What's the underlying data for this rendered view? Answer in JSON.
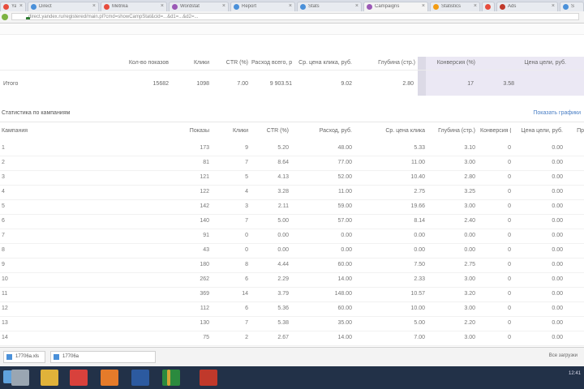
{
  "browser": {
    "tabs": [
      {
        "title": "Yandex",
        "favicon_color": "#e74c3c"
      },
      {
        "title": "Direct",
        "favicon_color": "#4a90d9"
      },
      {
        "title": "Metrika",
        "favicon_color": "#e74c3c"
      },
      {
        "title": "Wordstat",
        "favicon_color": "#9b59b6"
      },
      {
        "title": "Report",
        "favicon_color": "#4a90d9"
      },
      {
        "title": "Stats",
        "favicon_color": "#4a90d9"
      },
      {
        "title": "Campaigns",
        "favicon_color": "#9b59b6"
      },
      {
        "title": "Statistics",
        "favicon_color": "#f39c12"
      },
      {
        "title": "Mail",
        "favicon_color": "#e74c3c"
      },
      {
        "title": "Ads",
        "favicon_color": "#c0392b"
      },
      {
        "title": "Search",
        "favicon_color": "#4a90d9"
      }
    ],
    "address": "direct.yandex.ru/registered/main.pl?cmd=showCampStat&cid=...&d1=...&d2=..."
  },
  "summary": {
    "headers": [
      "",
      "Кол-во показов",
      "Клики",
      "CTR (%)",
      "Расход всего, руб.",
      "Ср. цена клика, руб.",
      "Глубина (стр.)",
      "Конверсия (%)",
      "Цена цели, руб."
    ],
    "row": [
      "Итого",
      "15682",
      "1098",
      "7.00",
      "9 903.51",
      "9.02",
      "2.80",
      "17",
      "3.58"
    ]
  },
  "section": {
    "title": "Статистика по кампаниям",
    "link": "Показать графики"
  },
  "columns": [
    "Кампания",
    "Показы",
    "Клики",
    "CTR (%)",
    "Расход, руб.",
    "Ср. цена клика",
    "Глубина (стр.)",
    "Конверсия (%)",
    "Цена цели, руб.",
    "Пр"
  ],
  "rows": [
    [
      "1",
      "173",
      "9",
      "5.20",
      "48.00",
      "5.33",
      "3.10",
      "0",
      "0.00"
    ],
    [
      "2",
      "81",
      "7",
      "8.64",
      "77.00",
      "11.00",
      "3.00",
      "0",
      "0.00"
    ],
    [
      "3",
      "121",
      "5",
      "4.13",
      "52.00",
      "10.40",
      "2.80",
      "0",
      "0.00"
    ],
    [
      "4",
      "122",
      "4",
      "3.28",
      "11.00",
      "2.75",
      "3.25",
      "0",
      "0.00"
    ],
    [
      "5",
      "142",
      "3",
      "2.11",
      "59.00",
      "19.66",
      "3.00",
      "0",
      "0.00"
    ],
    [
      "6",
      "140",
      "7",
      "5.00",
      "57.00",
      "8.14",
      "2.40",
      "0",
      "0.00"
    ],
    [
      "7",
      "91",
      "0",
      "0.00",
      "0.00",
      "0.00",
      "0.00",
      "0",
      "0.00"
    ],
    [
      "8",
      "43",
      "0",
      "0.00",
      "0.00",
      "0.00",
      "0.00",
      "0",
      "0.00"
    ],
    [
      "9",
      "180",
      "8",
      "4.44",
      "60.00",
      "7.50",
      "2.75",
      "0",
      "0.00"
    ],
    [
      "10",
      "262",
      "6",
      "2.29",
      "14.00",
      "2.33",
      "3.00",
      "0",
      "0.00"
    ],
    [
      "11",
      "369",
      "14",
      "3.79",
      "148.00",
      "10.57",
      "3.20",
      "0",
      "0.00"
    ],
    [
      "12",
      "112",
      "6",
      "5.36",
      "60.00",
      "10.00",
      "3.00",
      "0",
      "0.00"
    ],
    [
      "13",
      "130",
      "7",
      "5.38",
      "35.00",
      "5.00",
      "2.20",
      "0",
      "0.00"
    ],
    [
      "14",
      "75",
      "2",
      "2.67",
      "14.00",
      "7.00",
      "3.00",
      "0",
      "0.00"
    ]
  ],
  "downloads": [
    {
      "name": "17706a.xls"
    },
    {
      "name": "17706a"
    }
  ],
  "downloads_show_all": "Все загрузки",
  "taskbar": {
    "apps": [
      {
        "name": "explorer",
        "color": "#9aa6b2"
      },
      {
        "name": "chrome",
        "color": "#e0b23a"
      },
      {
        "name": "yandex",
        "color": "#d8413c"
      },
      {
        "name": "firefox",
        "color": "#e57b2a"
      },
      {
        "name": "word",
        "color": "#2c5aa0"
      },
      {
        "name": "excel",
        "color": "#2b8a3e"
      },
      {
        "name": "winamp",
        "color": "#d4a437"
      },
      {
        "name": "acrobat",
        "color": "#c0392b"
      }
    ],
    "tray_time": "12:41"
  }
}
